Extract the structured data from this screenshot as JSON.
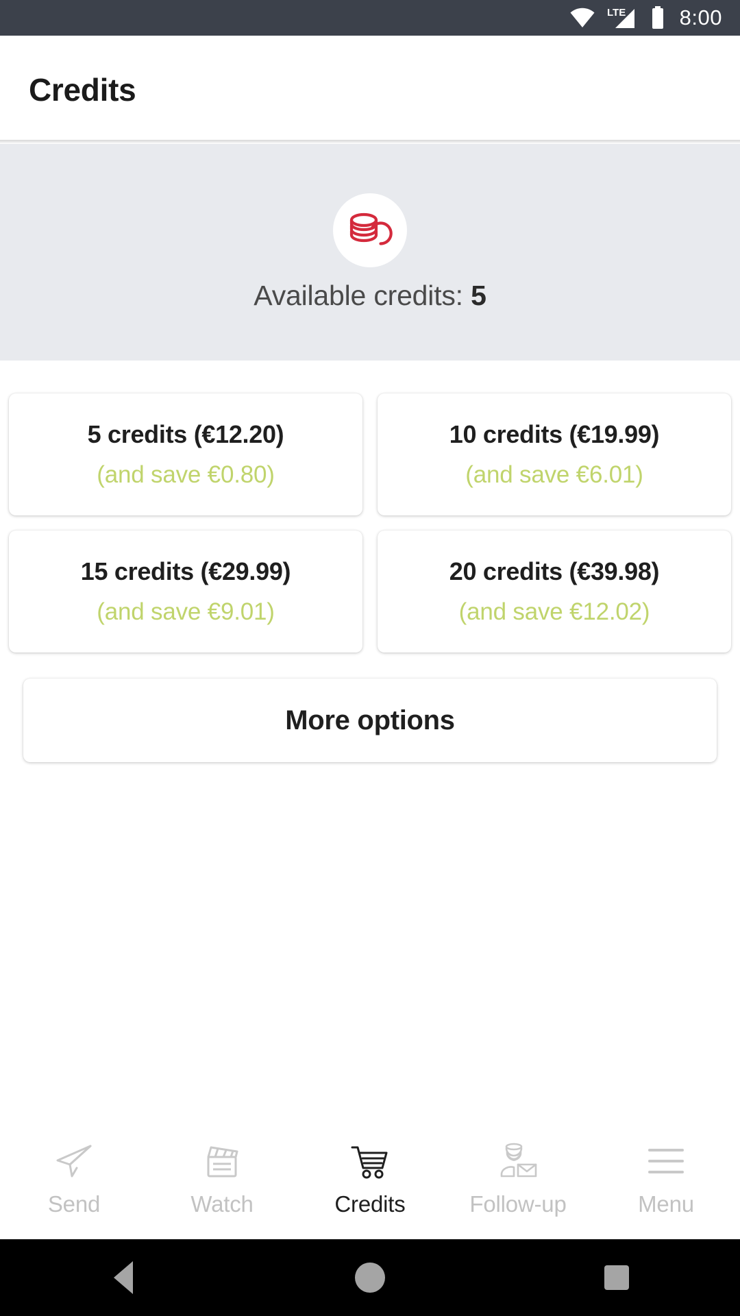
{
  "statusbar": {
    "wifi_icon": "wifi-icon",
    "network_label": "LTE",
    "signal_icon": "cellular-signal-icon",
    "battery_icon": "battery-full-icon",
    "time": "8:00"
  },
  "header": {
    "title": "Credits"
  },
  "banner": {
    "icon": "coins-stack-icon",
    "label_prefix": "Available credits: ",
    "credits_value": "5",
    "background_color": "#e8eaee",
    "icon_color": "#d42a3c"
  },
  "main": {
    "packages": [
      {
        "title": "5 credits (€12.20)",
        "savings": "(and save €0.80)"
      },
      {
        "title": "10 credits (€19.99)",
        "savings": "(and save €6.01)"
      },
      {
        "title": "15 credits (€29.99)",
        "savings": "(and save €9.01)"
      },
      {
        "title": "20 credits (€39.98)",
        "savings": "(and save €12.02)"
      }
    ],
    "more_options_label": "More options",
    "savings_color": "#c0d46c"
  },
  "bottomnav": {
    "items": [
      {
        "label": "Send",
        "icon": "paper-plane-icon",
        "active": false
      },
      {
        "label": "Watch",
        "icon": "clapperboard-icon",
        "active": false
      },
      {
        "label": "Credits",
        "icon": "shopping-cart-icon",
        "active": true
      },
      {
        "label": "Follow-up",
        "icon": "postman-mail-icon",
        "active": false
      },
      {
        "label": "Menu",
        "icon": "hamburger-menu-icon",
        "active": false
      }
    ],
    "active_color": "#1f1f1f",
    "inactive_color": "#c2c2c2"
  },
  "androidnav": {
    "back": "back-triangle-icon",
    "home": "home-circle-icon",
    "recents": "recents-square-icon"
  }
}
